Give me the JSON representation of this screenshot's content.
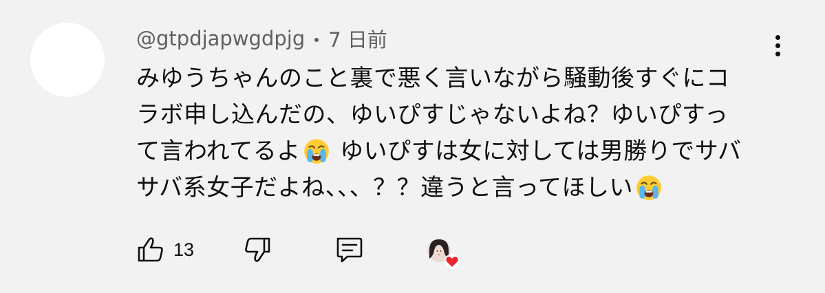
{
  "comment": {
    "author": "@gtpdjapwgdpjg",
    "time_ago": "7 日前",
    "text_lines": [
      [
        "みゆうちゃんのこと裏で悪く言いながら騒動後すぐにコ"
      ],
      [
        "ラボ申し込んだの、ゆいぴすじゃないよね？ゆいぴすっ"
      ],
      [
        "て言われてるよ",
        "emoji:loudly-crying-face",
        " ゆいぴすは女に対しては男勝りでサバ"
      ],
      [
        "サバ系女子だよね、、、？？違うと言ってほしい",
        "emoji:loudly-crying-face"
      ]
    ],
    "like_count": "13"
  },
  "icons": {
    "more": "vertical-ellipsis-icon",
    "like": "thumbs-up-icon",
    "dislike": "thumbs-down-icon",
    "reply": "reply-comment-icon",
    "heart": "creator-heart-icon",
    "emoji": "loudly-crying-face-emoji"
  },
  "colors": {
    "background": "#f2f2f2",
    "meta_text": "#606060",
    "text": "#0f0f0f",
    "heart": "#e8262c"
  }
}
